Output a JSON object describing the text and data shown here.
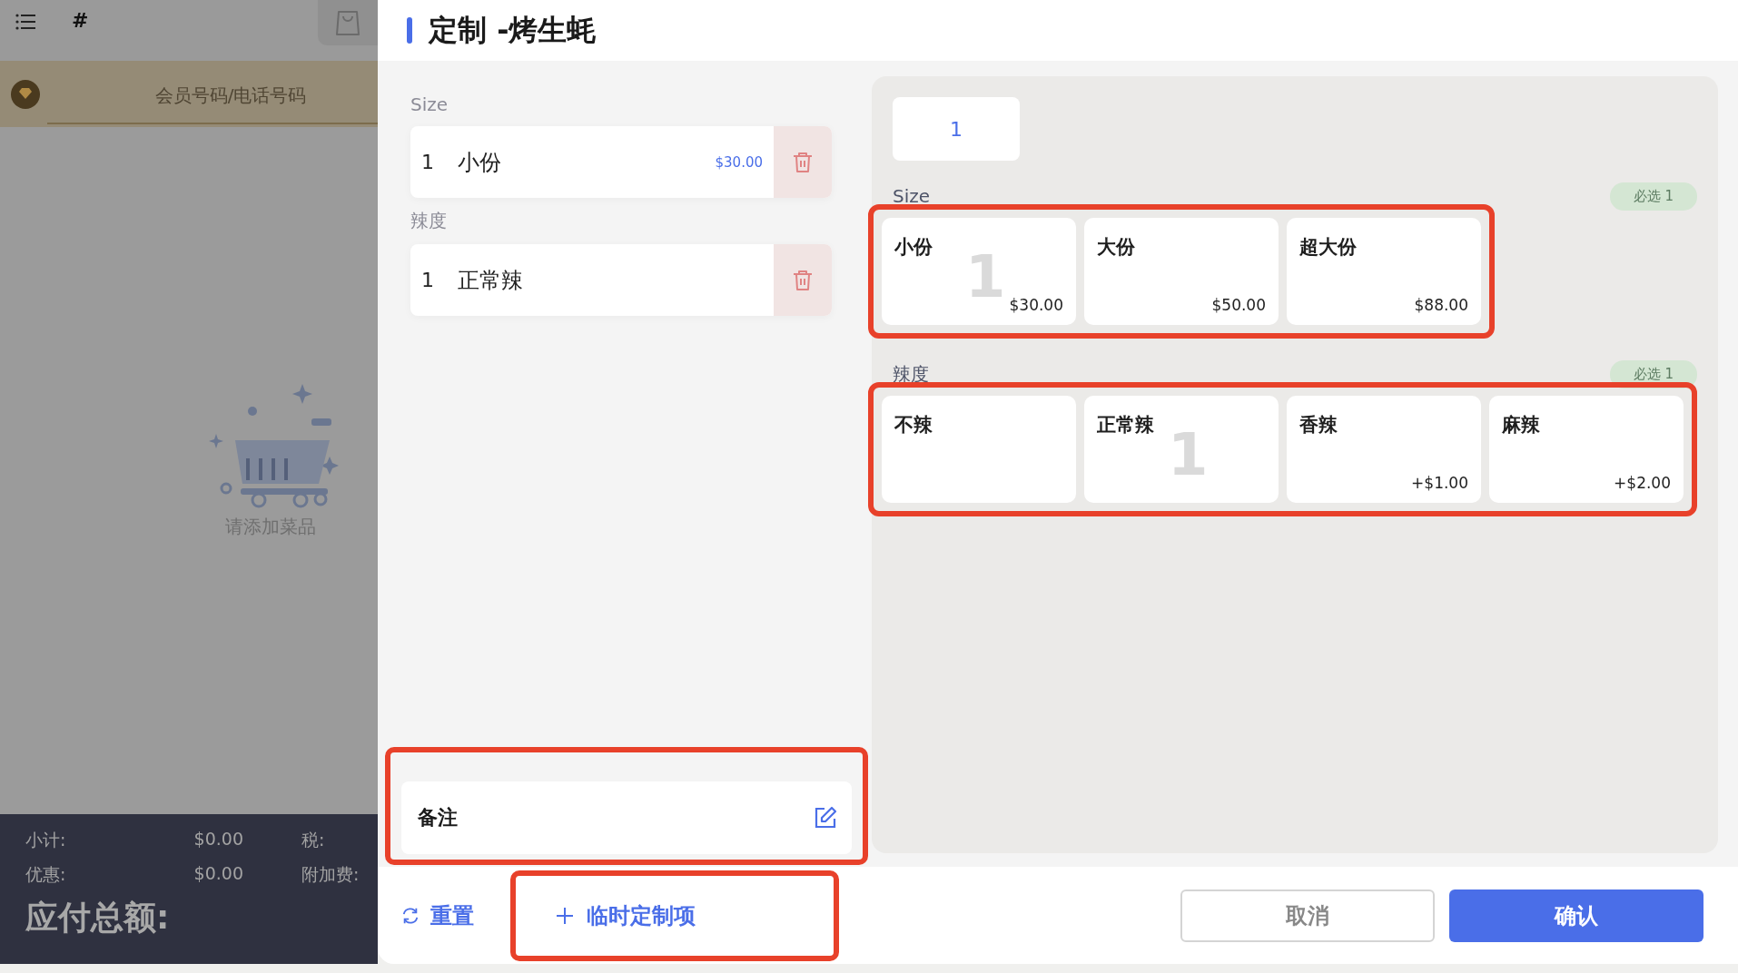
{
  "sidebar": {
    "hash": "#",
    "member_placeholder": "会员号码/电话号码",
    "empty_text": "请添加菜品",
    "summary": [
      {
        "label": "小计:",
        "value": "$0.00",
        "extra_label": "税:"
      },
      {
        "label": "优惠:",
        "value": "$0.00",
        "extra_label": "附加费:"
      }
    ],
    "total_label": "应付总额:"
  },
  "dialog": {
    "title": "定制 -烤生蚝",
    "chosen_groups": [
      {
        "name": "Size",
        "items": [
          {
            "qty": "1",
            "name": "小份",
            "price": "$30.00"
          }
        ]
      },
      {
        "name": "辣度",
        "items": [
          {
            "qty": "1",
            "name": "正常辣"
          }
        ]
      }
    ],
    "note": {
      "label": "备注",
      "highlighted": true
    },
    "quantity": "1",
    "option_groups": [
      {
        "name": "Size",
        "badge": "必选 1",
        "highlighted": true,
        "options": [
          {
            "name": "小份",
            "price": "$30.00",
            "count": "1"
          },
          {
            "name": "大份",
            "price": "$50.00"
          },
          {
            "name": "超大份",
            "price": "$88.00"
          }
        ]
      },
      {
        "name": "辣度",
        "badge": "必选 1",
        "highlighted": true,
        "options": [
          {
            "name": "不辣"
          },
          {
            "name": "正常辣",
            "count": "1"
          },
          {
            "name": "香辣",
            "price": "+$1.00"
          },
          {
            "name": "麻辣",
            "price": "+$2.00"
          }
        ]
      }
    ],
    "footer": {
      "reset": "重置",
      "temp_item": {
        "label": "临时定制项",
        "highlighted": true
      },
      "cancel": "取消",
      "confirm": "确认"
    }
  }
}
